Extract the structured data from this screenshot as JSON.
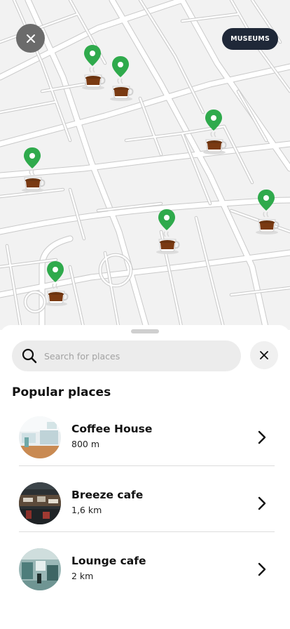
{
  "map": {
    "close_icon": "close-icon",
    "filter_chip_label": "MUSEUMS",
    "marker_icon": "location-pin-icon",
    "marker_image": "coffee-cup-icon",
    "pin_color": "#2faa4c",
    "marker_count": 7
  },
  "sheet": {
    "search_placeholder": "Search for places",
    "search_value": "",
    "search_icon": "search-icon",
    "clear_icon": "close-icon",
    "section_title": "Popular places",
    "places": [
      {
        "name": "Coffee House",
        "distance": "800 m",
        "image": "cafe-photo"
      },
      {
        "name": "Breeze cafe",
        "distance": "1,6 km",
        "image": "cafe-photo"
      },
      {
        "name": "Lounge cafe",
        "distance": "2 km",
        "image": "cafe-photo"
      }
    ]
  },
  "colors": {
    "map_background": "#f2f2f2",
    "street": "#ffffff",
    "street_outline": "#c9c9c9",
    "chip_background": "#1f2838",
    "pin_green": "#2faa4c"
  }
}
